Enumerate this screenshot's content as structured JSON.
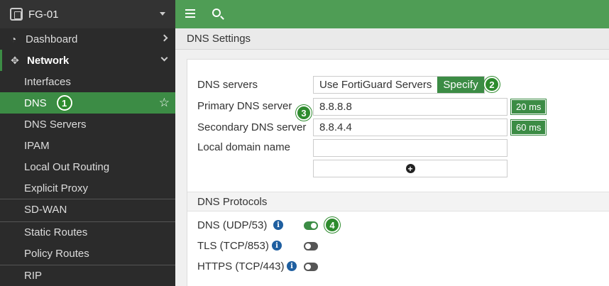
{
  "device": {
    "name": "FG-01"
  },
  "sidebar": {
    "items": [
      {
        "label": "Dashboard"
      },
      {
        "label": "Network"
      },
      {
        "label": "Interfaces"
      },
      {
        "label": "DNS"
      },
      {
        "label": "DNS Servers"
      },
      {
        "label": "IPAM"
      },
      {
        "label": "Local Out Routing"
      },
      {
        "label": "Explicit Proxy"
      },
      {
        "label": "SD-WAN"
      },
      {
        "label": "Static Routes"
      },
      {
        "label": "Policy Routes"
      },
      {
        "label": "RIP"
      }
    ]
  },
  "page": {
    "title": "DNS Settings"
  },
  "form": {
    "dns_servers_label": "DNS servers",
    "options": [
      "Use FortiGuard Servers",
      "Specify"
    ],
    "selected_option": "Specify",
    "primary_label": "Primary DNS server",
    "primary_value": "8.8.8.8",
    "primary_latency": "20 ms",
    "secondary_label": "Secondary DNS server",
    "secondary_value": "8.8.4.4",
    "secondary_latency": "60 ms",
    "local_domain_label": "Local domain name",
    "local_domain_value": ""
  },
  "protocols": {
    "heading": "DNS Protocols",
    "items": [
      {
        "label": "DNS (UDP/53)",
        "enabled": true
      },
      {
        "label": "TLS (TCP/853)",
        "enabled": false
      },
      {
        "label": "HTTPS (TCP/443)",
        "enabled": false
      }
    ]
  },
  "callouts": [
    "1",
    "2",
    "3",
    "4"
  ],
  "colors": {
    "accent": "#3c8c45",
    "topbar": "#4f9d55",
    "sidebar": "#2b2b2b",
    "info": "#1f5fa0"
  }
}
